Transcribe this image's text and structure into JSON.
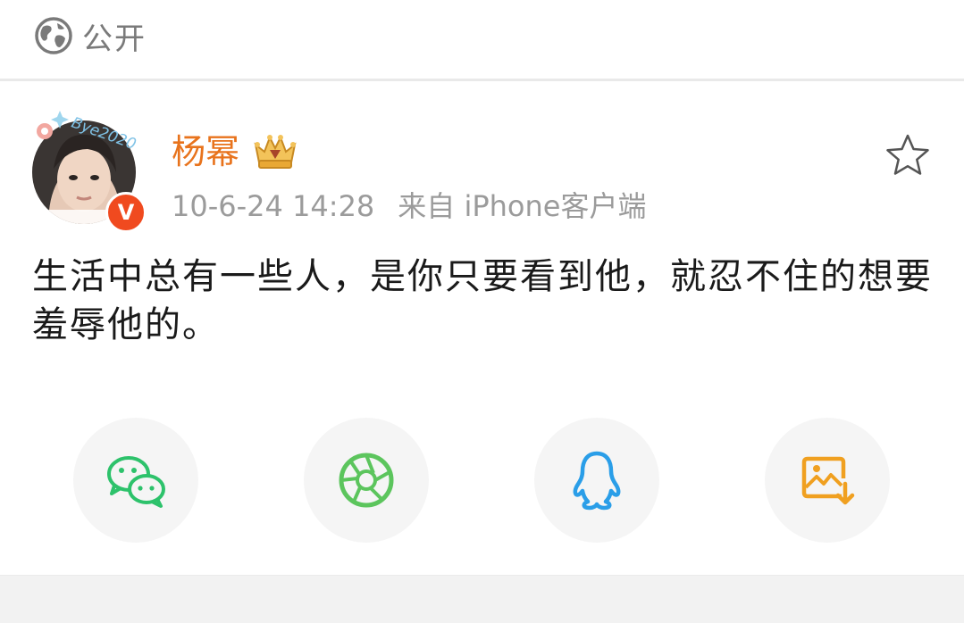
{
  "header": {
    "visibility_icon": "globe-icon",
    "visibility_label": "公开"
  },
  "post": {
    "author": {
      "name": "杨幂",
      "avatar_caption": "Bye2020",
      "verified_badge": "V",
      "member_icon": "crown-badge-icon"
    },
    "timestamp": "10-6-24 14:28",
    "source": "来自 iPhone客户端",
    "favorite_icon": "star-outline-icon",
    "text": "生活中总有一些人，是你只要看到他，就忍不住的想要羞辱他的。"
  },
  "share": [
    {
      "name": "wechat",
      "icon": "wechat-icon",
      "color": "#2dc26b"
    },
    {
      "name": "moments",
      "icon": "aperture-icon",
      "color": "#5cc55d"
    },
    {
      "name": "qq",
      "icon": "penguin-icon",
      "color": "#2a9ee8"
    },
    {
      "name": "save-image",
      "icon": "image-download-icon",
      "color": "#f0a020"
    }
  ],
  "colors": {
    "username": "#e8731c",
    "meta_gray": "#9b9b9b",
    "badge_red": "#f04a1f"
  }
}
